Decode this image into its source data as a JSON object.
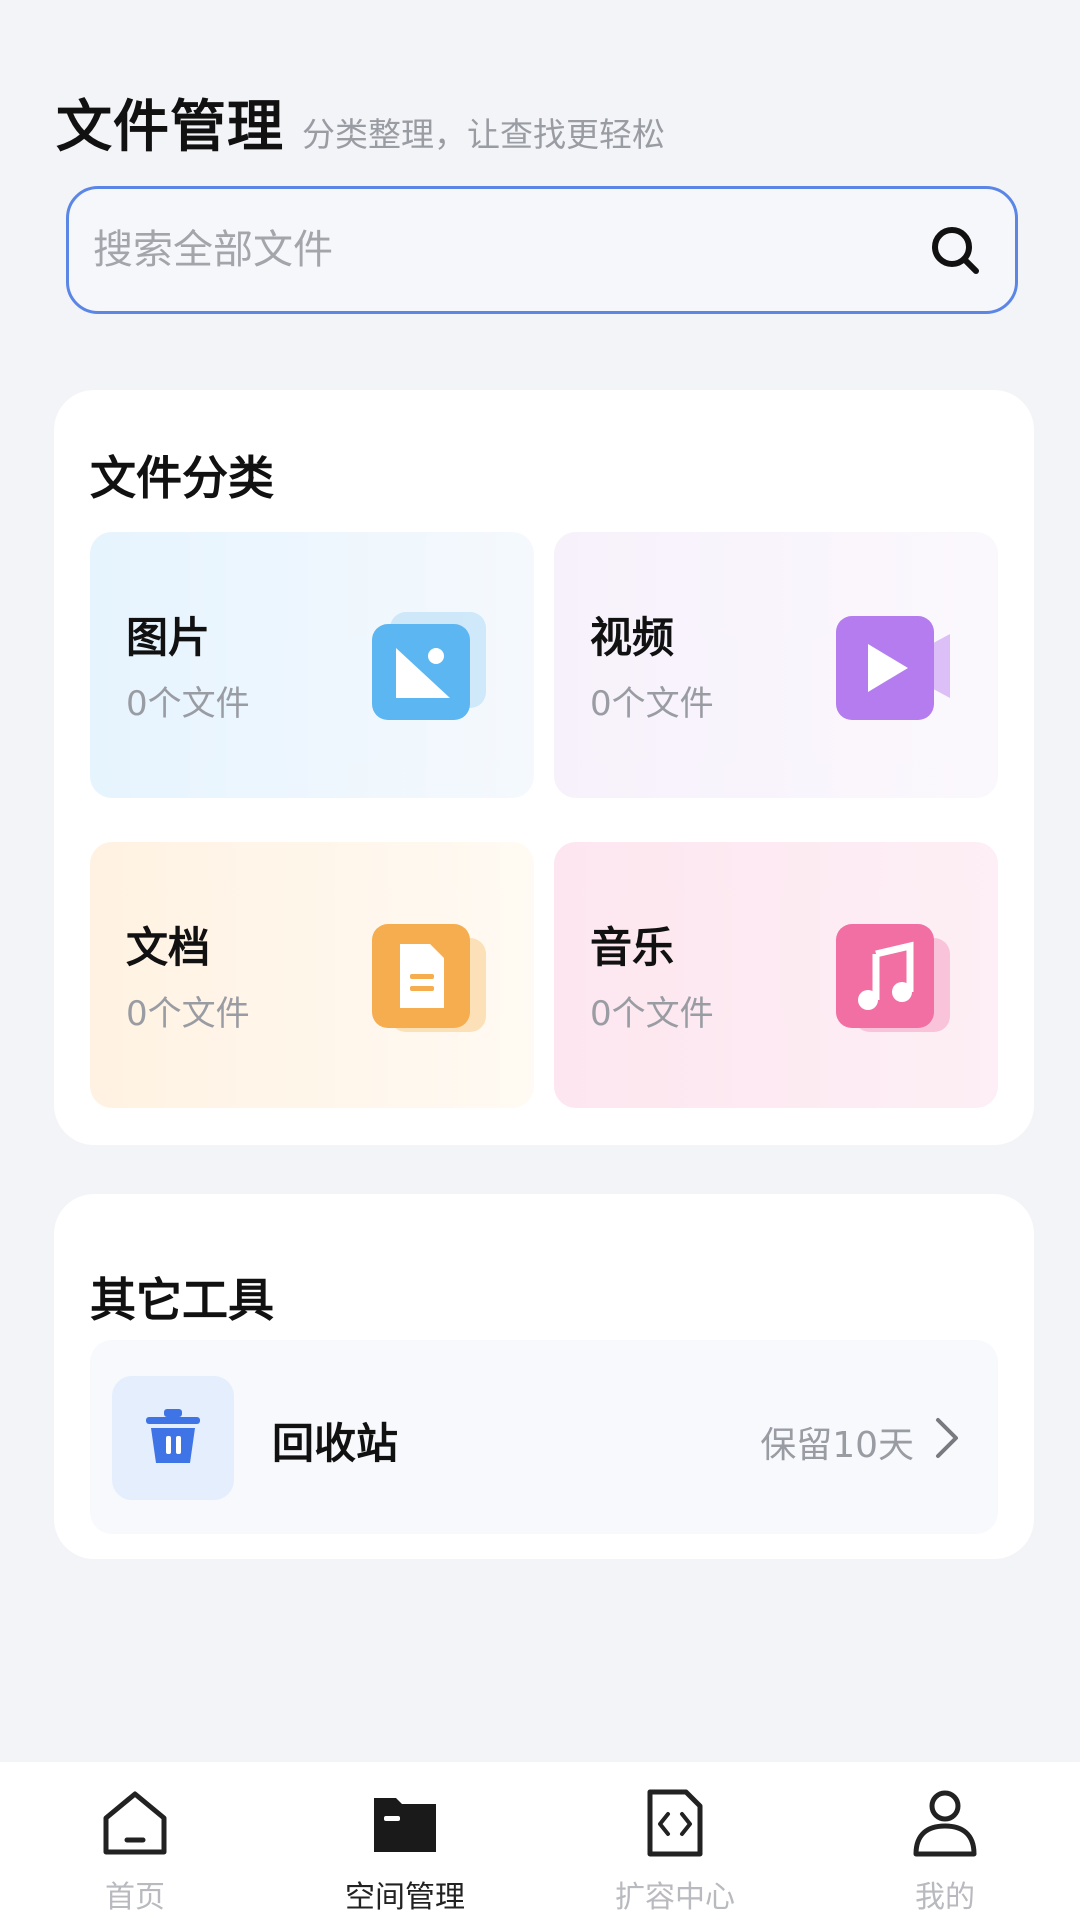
{
  "header": {
    "title": "文件管理",
    "subtitle": "分类整理，让查找更轻松"
  },
  "search": {
    "placeholder": "搜索全部文件",
    "value": ""
  },
  "categories": {
    "title": "文件分类",
    "items": [
      {
        "name": "图片",
        "count": "0个文件",
        "icon": "image-icon",
        "color": "#5cb6f2"
      },
      {
        "name": "视频",
        "count": "0个文件",
        "icon": "video-icon",
        "color": "#b57cef"
      },
      {
        "name": "文档",
        "count": "0个文件",
        "icon": "document-icon",
        "color": "#f6ad4f"
      },
      {
        "name": "音乐",
        "count": "0个文件",
        "icon": "music-icon",
        "color": "#f16fa3"
      }
    ]
  },
  "tools": {
    "title": "其它工具",
    "recycle_bin": {
      "label": "回收站",
      "note": "保留10天",
      "icon": "trash-icon",
      "color": "#3f74e6"
    }
  },
  "nav": {
    "items": [
      {
        "label": "首页",
        "icon": "home-icon",
        "active": false
      },
      {
        "label": "空间管理",
        "icon": "folder-icon",
        "active": true
      },
      {
        "label": "扩容中心",
        "icon": "code-file-icon",
        "active": false
      },
      {
        "label": "我的",
        "icon": "person-icon",
        "active": false
      }
    ]
  }
}
